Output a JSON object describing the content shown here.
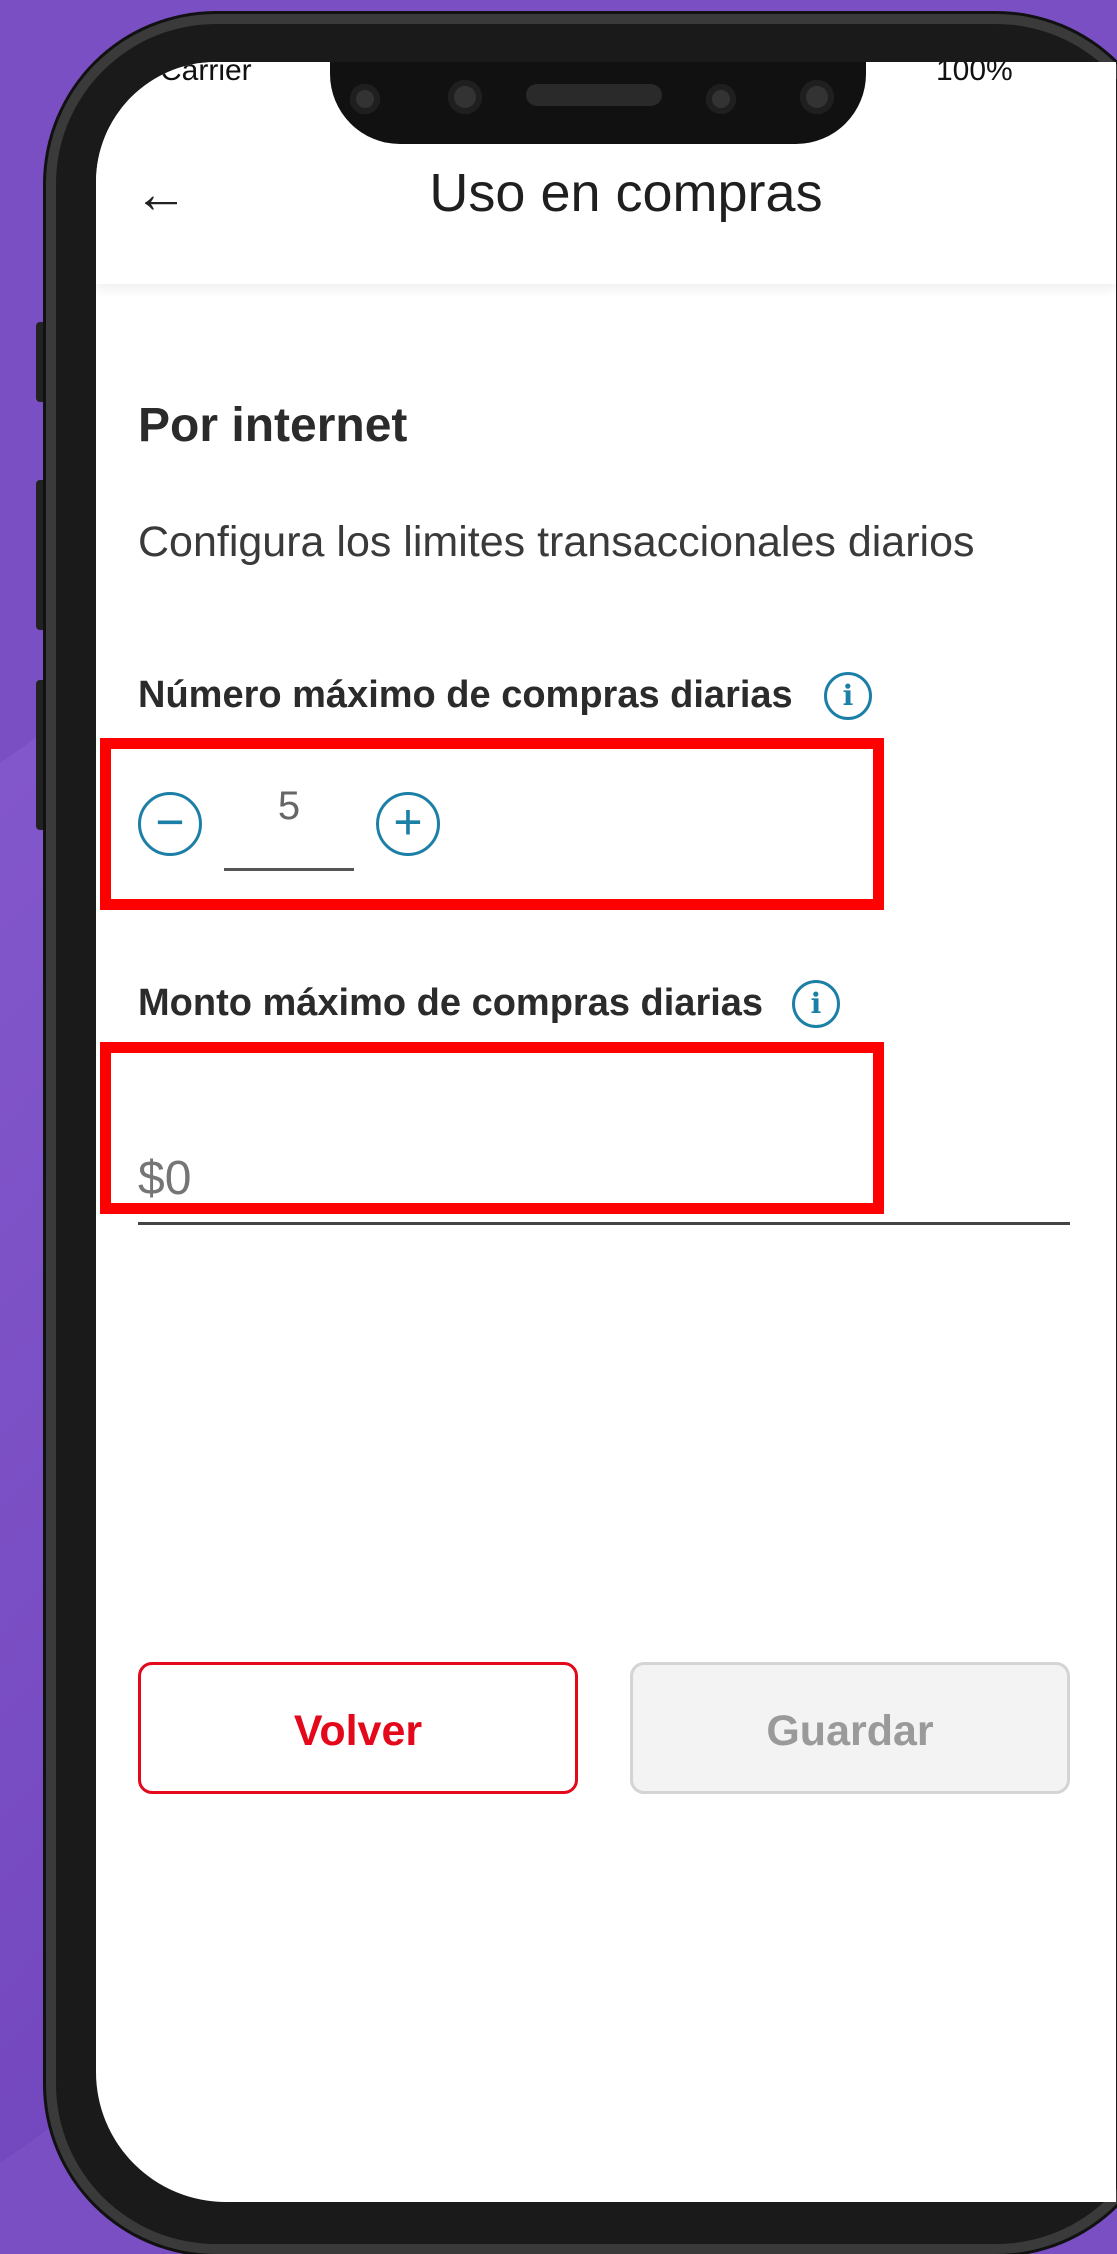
{
  "status_bar": {
    "carrier": "Carrier",
    "battery": "100%"
  },
  "header": {
    "title": "Uso en compras",
    "back_icon": "←"
  },
  "section": {
    "title": "Por internet",
    "subtitle": "Configura los limites transaccionales diarios"
  },
  "max_purchases": {
    "label": "Número máximo de compras diarias",
    "value": "5",
    "minus_symbol": "−",
    "plus_symbol": "+",
    "info_symbol": "i"
  },
  "max_amount": {
    "label": "Monto máximo de compras diarias",
    "placeholder": "$0",
    "info_symbol": "i"
  },
  "buttons": {
    "back": "Volver",
    "save": "Guardar"
  },
  "colors": {
    "background": "#7b4fc4",
    "accent_red": "#e3081a",
    "info_blue": "#1b7fa6",
    "highlight": "#ff0000"
  }
}
